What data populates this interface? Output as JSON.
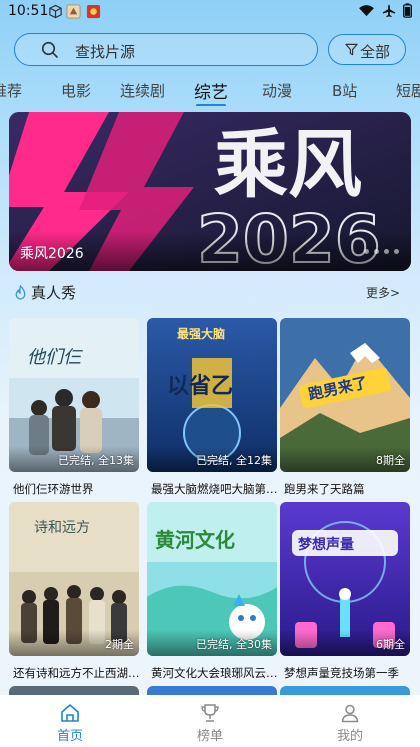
{
  "status_bar": {
    "time": "10:51"
  },
  "search": {
    "placeholder": "查找片源",
    "filter_label": "全部"
  },
  "tabs": [
    {
      "label": "推荐"
    },
    {
      "label": "电影"
    },
    {
      "label": "连续剧"
    },
    {
      "label": "综艺",
      "active": true
    },
    {
      "label": "动漫"
    },
    {
      "label": "B站"
    },
    {
      "label": "短剧"
    }
  ],
  "banner": {
    "title": "乘风2026",
    "art_text": "乘风",
    "art_year": "2026"
  },
  "section": {
    "title": "真人秀",
    "more_label": "更多>"
  },
  "cards": [
    {
      "title": "他们仨环游世界",
      "badge": "已完结, 全13集"
    },
    {
      "title": "最强大脑燃烧吧大脑第三季",
      "badge": "已完结, 全12集"
    },
    {
      "title": "跑男来了天路篇",
      "badge": "8期全"
    },
    {
      "title": "还有诗和远方不止西湖第三季",
      "badge": "2期全"
    },
    {
      "title": "黄河文化大会琅琊风云第一季",
      "badge": "已完结, 全30集"
    },
    {
      "title": "梦想声量竞技场第一季",
      "badge": "6期全"
    }
  ],
  "bottom_nav": [
    {
      "label": "首页",
      "icon": "home-icon",
      "active": true
    },
    {
      "label": "榜单",
      "icon": "trophy-icon"
    },
    {
      "label": "我的",
      "icon": "profile-icon"
    }
  ],
  "colors": {
    "accent": "#1f83d6",
    "nav_inactive": "#8a8a8a"
  }
}
